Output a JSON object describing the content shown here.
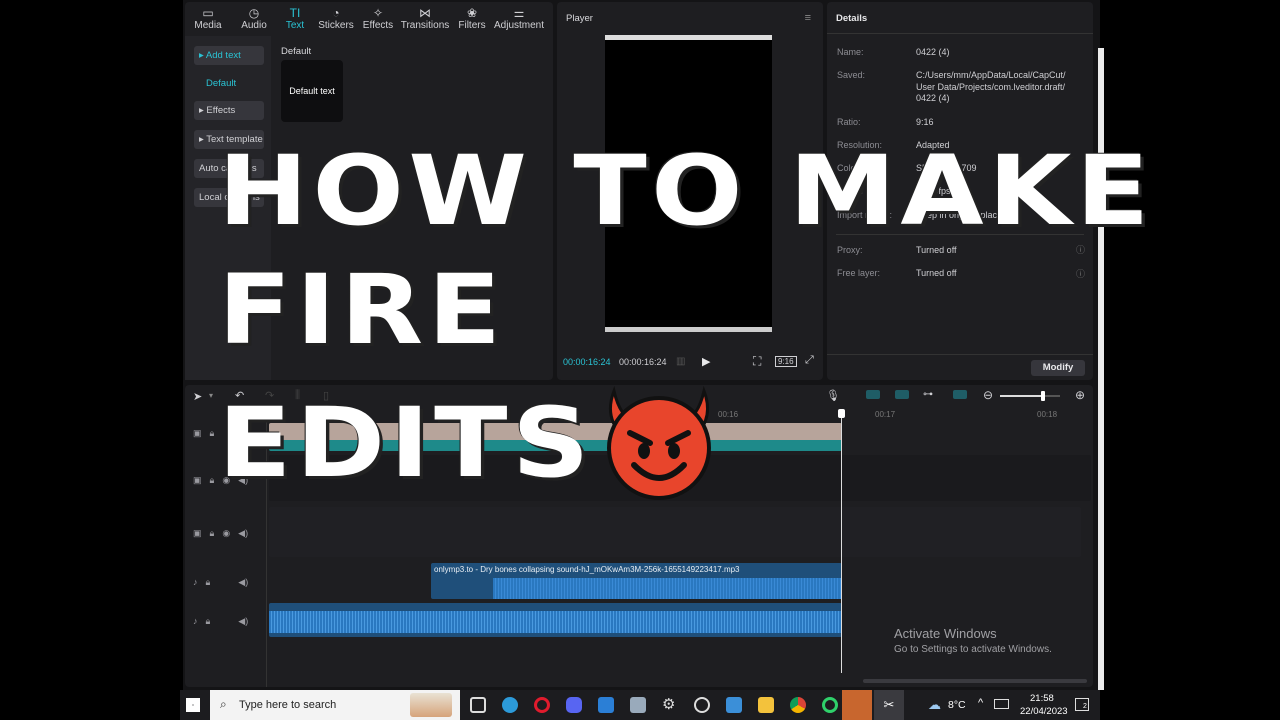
{
  "media_toolbar": {
    "tabs": [
      {
        "label": "Media",
        "icon": "media-icon"
      },
      {
        "label": "Audio",
        "icon": "audio-icon"
      },
      {
        "label": "Text",
        "icon": "text-icon"
      },
      {
        "label": "Stickers",
        "icon": "stickers-icon"
      },
      {
        "label": "Effects",
        "icon": "effects-icon"
      },
      {
        "label": "Transitions",
        "icon": "transitions-icon"
      },
      {
        "label": "Filters",
        "icon": "filters-icon"
      },
      {
        "label": "Adjustment",
        "icon": "adjustment-icon"
      }
    ],
    "active_tab": "Text"
  },
  "text_sidebar": {
    "items": [
      "▸ Add text",
      "Default",
      "▸ Effects",
      "▸ Text template",
      "Auto captions",
      "Local captions"
    ]
  },
  "text_library": {
    "section_title": "Default",
    "item_label": "Default text"
  },
  "player": {
    "title": "Player",
    "current_time": "00:00:16:24",
    "total_time": "00:00:16:24",
    "ratio_button": "9:16"
  },
  "details": {
    "title": "Details",
    "rows": [
      {
        "label": "Name:",
        "value": "0422 (4)"
      },
      {
        "label": "Saved:",
        "value": "C:/Users/mm/AppData/Local/CapCut/\nUser Data/Projects/com.lveditor.draft/\n0422 (4)"
      },
      {
        "label": "Ratio:",
        "value": "9:16"
      },
      {
        "label": "Resolution:",
        "value": "Adapted"
      },
      {
        "label": "Color space:",
        "value": "SDR - Rec.709"
      },
      {
        "label": "Frame rate:",
        "value": "30.00fps"
      },
      {
        "label": "Import media:",
        "value": "Keep in original place"
      },
      {
        "label": "Proxy:",
        "value": "Turned off"
      },
      {
        "label": "Free layer:",
        "value": "Turned off"
      }
    ],
    "modify_button": "Modify"
  },
  "timeline": {
    "ruler_labels": [
      "00:16",
      "00:17",
      "00:18"
    ],
    "audio_clip_title": "onlymp3.to - Dry bones collapsing sound-hJ_mOKwAm3M-256k-1655149223417.mp3",
    "zoom_level_fraction": 0.72
  },
  "overlay": {
    "lines": [
      "HOW TO MAKE",
      "FIRE",
      "EDITS"
    ],
    "emoji": "😈"
  },
  "watermark": {
    "title": "Activate Windows",
    "subtitle": "Go to Settings to activate Windows."
  },
  "taskbar": {
    "search_placeholder": "Type here to search",
    "weather": "8°C",
    "time": "21:58",
    "date": "22/04/2023",
    "notification_count": "2"
  },
  "colors": {
    "accent": "#2ac3d4",
    "video_track": "#1e8a8a",
    "audio_clip": "#1f4f7a",
    "audio_wave": "#2a78c0",
    "emoji_red": "#e8452c"
  }
}
